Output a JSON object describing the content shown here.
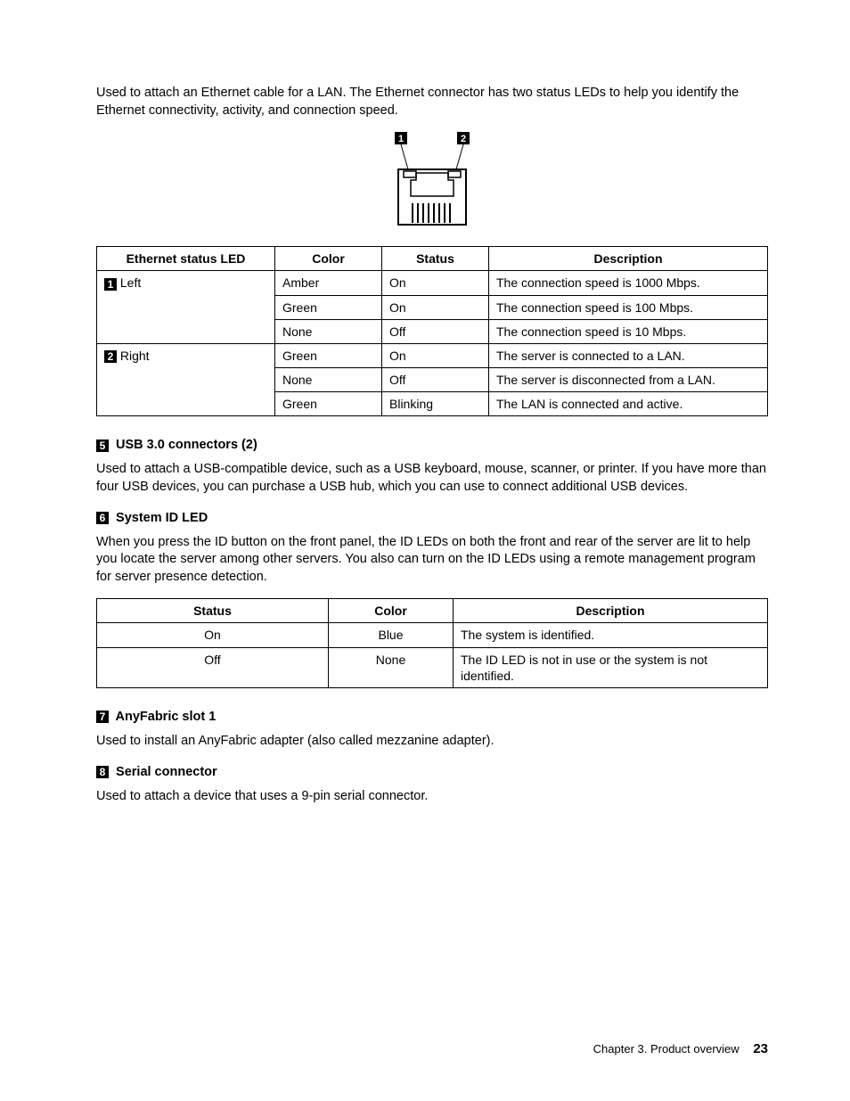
{
  "intro_para": "Used to attach an Ethernet cable for a LAN. The Ethernet connector has two status LEDs to help you identify the Ethernet connectivity, activity, and connection speed.",
  "diagram": {
    "callout1": "1",
    "callout2": "2"
  },
  "table1": {
    "headers": {
      "h1": "Ethernet status LED",
      "h2": "Color",
      "h3": "Status",
      "h4": "Description"
    },
    "groups": [
      {
        "callout": "1",
        "label": "Left",
        "rows": [
          {
            "color": "Amber",
            "status": "On",
            "desc": "The connection speed is 1000 Mbps."
          },
          {
            "color": "Green",
            "status": "On",
            "desc": "The connection speed is 100 Mbps."
          },
          {
            "color": "None",
            "status": "Off",
            "desc": "The connection speed is 10 Mbps."
          }
        ]
      },
      {
        "callout": "2",
        "label": "Right",
        "rows": [
          {
            "color": "Green",
            "status": "On",
            "desc": "The server is connected to a LAN."
          },
          {
            "color": "None",
            "status": "Off",
            "desc": "The server is disconnected from a LAN."
          },
          {
            "color": "Green",
            "status": "Blinking",
            "desc": "The LAN is connected and active."
          }
        ]
      }
    ]
  },
  "sec5": {
    "callout": "5",
    "title": "USB 3.0 connectors (2)",
    "body": "Used to attach a USB-compatible device, such as a USB keyboard, mouse, scanner, or printer. If you have more than four USB devices, you can purchase a USB hub, which you can use to connect additional USB devices."
  },
  "sec6": {
    "callout": "6",
    "title": "System ID LED",
    "body": "When you press the ID button on the front panel, the ID LEDs on both the front and rear of the server are lit to help you locate the server among other servers. You also can turn on the ID LEDs using a remote management program for server presence detection."
  },
  "table2": {
    "headers": {
      "h1": "Status",
      "h2": "Color",
      "h3": "Description"
    },
    "rows": [
      {
        "status": "On",
        "color": "Blue",
        "desc": "The system is identified."
      },
      {
        "status": "Off",
        "color": "None",
        "desc": "The ID LED is not in use or the system is not identified."
      }
    ]
  },
  "sec7": {
    "callout": "7",
    "title": "AnyFabric slot 1",
    "body": "Used to install an AnyFabric adapter (also called mezzanine adapter)."
  },
  "sec8": {
    "callout": "8",
    "title": "Serial connector",
    "body": "Used to attach a device that uses a 9-pin serial connector."
  },
  "footer": {
    "chapter": "Chapter 3. Product overview",
    "page": "23"
  }
}
